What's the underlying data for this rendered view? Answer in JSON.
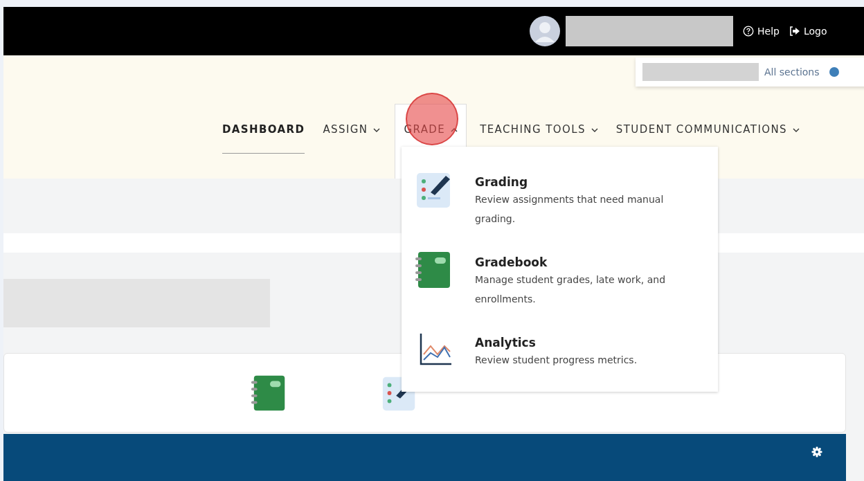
{
  "top_bar": {
    "links": [
      {
        "kind": "help",
        "label": "Help"
      },
      {
        "kind": "logout",
        "label": "Logo"
      }
    ]
  },
  "section_popover": {
    "label": "All sections"
  },
  "nav": [
    {
      "label": "DASHBOARD",
      "selected": true,
      "has_menu": false,
      "expanded": false
    },
    {
      "label": "ASSIGN",
      "selected": false,
      "has_menu": true,
      "expanded": false
    },
    {
      "label": "GRADE",
      "selected": false,
      "has_menu": true,
      "expanded": true
    },
    {
      "label": "TEACHING TOOLS",
      "selected": false,
      "has_menu": true,
      "expanded": false
    },
    {
      "label": "STUDENT COMMUNICATIONS",
      "selected": false,
      "has_menu": true,
      "expanded": false
    }
  ],
  "grade_menu": [
    {
      "kind": "grading",
      "title": "Grading",
      "description": "Review assignments that need manual grading."
    },
    {
      "kind": "gradebook",
      "title": "Gradebook",
      "description": "Manage student grades, late work, and enrollments."
    },
    {
      "kind": "analytics",
      "title": "Analytics",
      "description": "Review student progress metrics."
    }
  ],
  "card_icons": [
    {
      "kind": "gradebook"
    },
    {
      "kind": "grading"
    }
  ]
}
